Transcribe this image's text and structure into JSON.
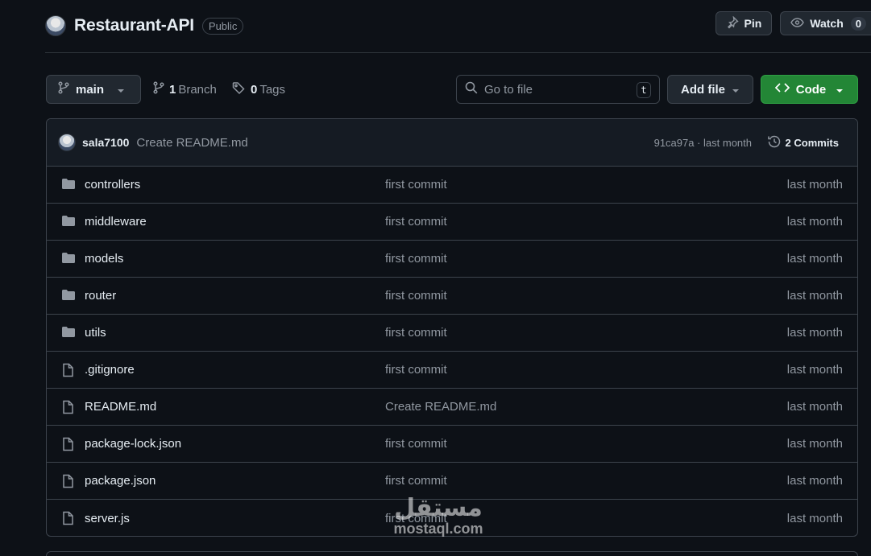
{
  "repo": {
    "name": "Restaurant-API",
    "visibility": "Public"
  },
  "header_actions": {
    "pin_label": "Pin",
    "watch_label": "Watch",
    "watch_count": "0"
  },
  "toolbar": {
    "branch": "main",
    "branch_count": "1",
    "branch_label": "Branch",
    "tag_count": "0",
    "tag_label": "Tags",
    "search_placeholder": "Go to file",
    "search_shortcut": "t",
    "add_file_label": "Add file",
    "code_label": "Code"
  },
  "latest_commit": {
    "author": "sala7100",
    "message": "Create README.md",
    "hash_and_time": "91ca97a · last month",
    "commits_label": "2 Commits"
  },
  "files": [
    {
      "name": "controllers",
      "type": "folder",
      "message": "first commit",
      "time": "last month"
    },
    {
      "name": "middleware",
      "type": "folder",
      "message": "first commit",
      "time": "last month"
    },
    {
      "name": "models",
      "type": "folder",
      "message": "first commit",
      "time": "last month"
    },
    {
      "name": "router",
      "type": "folder",
      "message": "first commit",
      "time": "last month"
    },
    {
      "name": "utils",
      "type": "folder",
      "message": "first commit",
      "time": "last month"
    },
    {
      "name": ".gitignore",
      "type": "file",
      "message": "first commit",
      "time": "last month"
    },
    {
      "name": "README.md",
      "type": "file",
      "message": "Create README.md",
      "time": "last month"
    },
    {
      "name": "package-lock.json",
      "type": "file",
      "message": "first commit",
      "time": "last month"
    },
    {
      "name": "package.json",
      "type": "file",
      "message": "first commit",
      "time": "last month"
    },
    {
      "name": "server.js",
      "type": "file",
      "message": "first commit",
      "time": "last month"
    }
  ],
  "watermark": {
    "arabic": "مستقل",
    "latin": "mostaql.com"
  },
  "icons": {
    "folder": "folder-icon",
    "file": "file-icon"
  },
  "colors": {
    "background": "#0d1117",
    "border": "#3d444d",
    "code_button": "#238636",
    "muted_text": "#9198a1",
    "folder_icon": "#9198a1"
  }
}
